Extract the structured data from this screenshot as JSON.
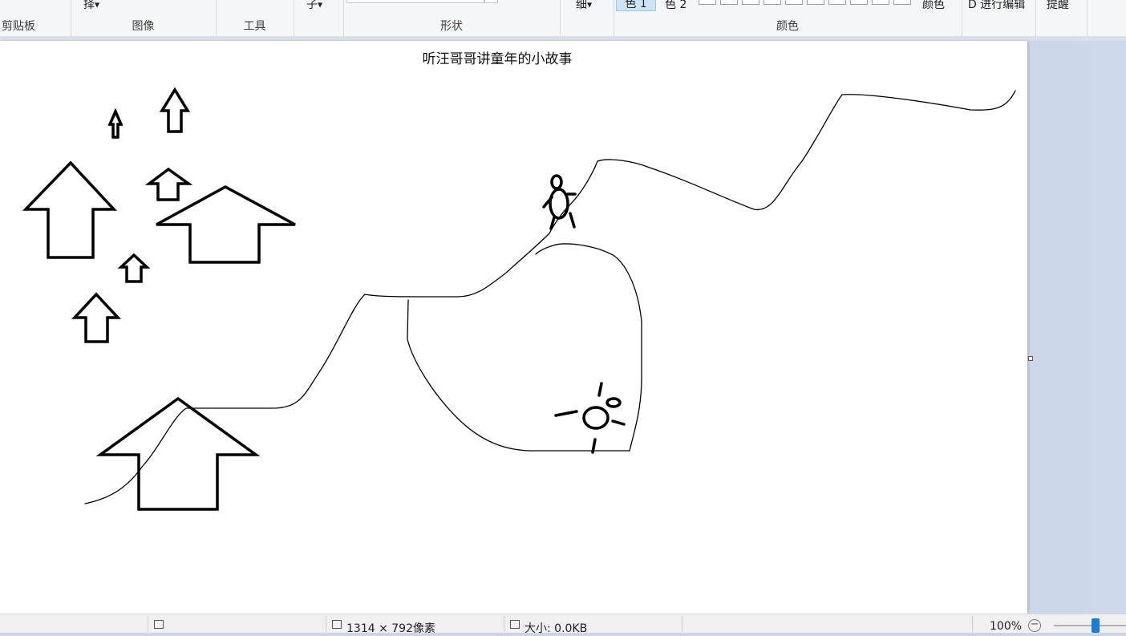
{
  "ribbon": {
    "clipboard_label": "剪贴板",
    "image_label": "图像",
    "tools_label": "工具",
    "shapes_label": "形状",
    "colors_label": "颜色",
    "select_fragment": "择",
    "brush_fragment": "子",
    "size_fragment": "细",
    "color1_label": "色 1",
    "color2_label": "色 2",
    "edit_colors_fragment": "颜色",
    "paint3d_fragment": "D 进行编辑",
    "alert_fragment": "提醒"
  },
  "canvas": {
    "title_text": "听汪哥哥讲童年的小故事",
    "background": "#ffffff",
    "stroke_color": "#000000"
  },
  "statusbar": {
    "dimensions": "1314 × 792像素",
    "size": "大小: 0.0KB",
    "zoom": "100%",
    "zoom_minus": "−"
  },
  "icons": {
    "select_icon": "selection-rectangle-icon",
    "dimension_icon": "canvas-size-icon",
    "save_icon": "disk-icon"
  },
  "colors": {
    "accent": "#1e7bd6",
    "selected_button": "#cce4f7"
  }
}
